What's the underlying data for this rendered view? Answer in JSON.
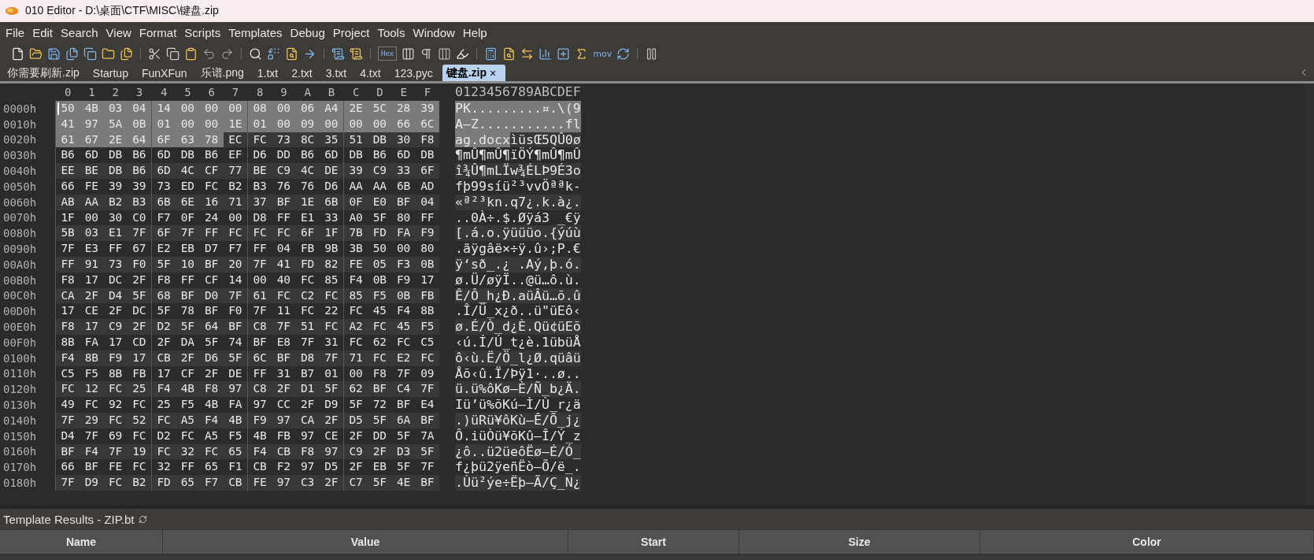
{
  "window": {
    "title": "010 Editor - D:\\桌面\\CTF\\MISC\\键盘.zip"
  },
  "menu": [
    "File",
    "Edit",
    "Search",
    "View",
    "Format",
    "Scripts",
    "Templates",
    "Debug",
    "Project",
    "Tools",
    "Window",
    "Help"
  ],
  "toolbar": {
    "hex_label": "Hex",
    "mov_label": "mov"
  },
  "tabs": [
    {
      "label": "你需要刷新.zip",
      "selected": false
    },
    {
      "label": "Startup",
      "selected": false
    },
    {
      "label": "FunXFun",
      "selected": false
    },
    {
      "label": "乐谱.png",
      "selected": false
    },
    {
      "label": "1.txt",
      "selected": false
    },
    {
      "label": "2.txt",
      "selected": false
    },
    {
      "label": "3.txt",
      "selected": false
    },
    {
      "label": "4.txt",
      "selected": false
    },
    {
      "label": "123.pyc",
      "selected": false
    },
    {
      "label": "键盘.zip",
      "selected": true,
      "close": "×"
    }
  ],
  "hex_view": {
    "columns": [
      "0",
      "1",
      "2",
      "3",
      "4",
      "5",
      "6",
      "7",
      "8",
      "9",
      "A",
      "B",
      "C",
      "D",
      "E",
      "F"
    ],
    "text_header": "0123456789ABCDEF",
    "rows": [
      {
        "offset": "0000h",
        "hex_selected": "50 4B 03 04 14 00 00 00 08 00 06 A4 2E 5C 28 39",
        "text_selected": "PK.........¤.\\(9"
      },
      {
        "offset": "0010h",
        "hex_selected": "41 97 5A 0B 01 00 00 1E 01 00 09 00 00 00 66 6C",
        "text_selected": "A—Z...........fl"
      },
      {
        "offset": "0020h",
        "hex_selected": "61 67 2E 64 6F 63 78",
        "hex": "EC FC 73 8C 35 51 DB 30 F8",
        "text_selected": "ag.docx",
        "text": "ìüsŒ5QÛ0ø"
      },
      {
        "offset": "0030h",
        "hex": "B6 6D DB B6 6D DB B6 EF D6 DD B6 6D DB B6 6D DB",
        "text": "¶mÛ¶mÛ¶ïÖÝ¶mÛ¶mÛ"
      },
      {
        "offset": "0040h",
        "hex": "EE BE DB B6 6D 4C CF 77 BE C9 4C DE 39 C9 33 6F",
        "text": "î¾Û¶mLÏw¾ÉLÞ9É3o"
      },
      {
        "offset": "0050h",
        "hex": "66 FE 39 39 73 ED FC B2 B3 76 76 D6 AA AA 6B AD",
        "text": "fþ99síü²³vvÖªªk-"
      },
      {
        "offset": "0060h",
        "hex": "AB AA B2 B3 6B 6E 16 71 37 BF 1E 6B 0F E0 BF 04",
        "text": "«ª²³kn.q7¿.k.à¿."
      },
      {
        "offset": "0070h",
        "hex": "1F 00 30 C0 F7 0F 24 00 D8 FF E1 33 A0 5F 80 FF",
        "text": "..0À÷.$.Øÿá3 _€ÿ"
      },
      {
        "offset": "0080h",
        "hex": "5B 03 E1 7F 6F 7F FF FC FC FC 6F 1F 7B FD FA F9",
        "text": "[.á.o.ÿüüüo.{ýúù"
      },
      {
        "offset": "0090h",
        "hex": "7F E3 FF 67 E2 EB D7 F7 FF 04 FB 9B 3B 50 00 80",
        "text": ".ãÿgâë×÷ÿ.û›;P.€"
      },
      {
        "offset": "00A0h",
        "hex": "FF 91 73 F0 5F 10 BF 20 7F 41 FD 82 FE 05 F3 0B",
        "text": "ÿ‘sð_.¿ .Aý‚þ.ó."
      },
      {
        "offset": "00B0h",
        "hex": "F8 17 DC 2F F8 FF CF 14 00 40 FC 85 F4 0B F9 17",
        "text": "ø.Ü/øÿÏ..@ü…ô.ù."
      },
      {
        "offset": "00C0h",
        "hex": "CA 2F D4 5F 68 BF D0 7F 61 FC C2 FC 85 F5 0B FB",
        "text": "Ê/Ô_h¿Ð.aüÂü…õ.û"
      },
      {
        "offset": "00D0h",
        "hex": "17 CE 2F DC 5F 78 BF F0 7F 11 FC 22 FC 45 F4 8B",
        "text": ".Î/Ü_x¿ð..ü\"üEô‹"
      },
      {
        "offset": "00E0h",
        "hex": "F8 17 C9 2F D2 5F 64 BF C8 7F 51 FC A2 FC 45 F5",
        "text": "ø.É/Ò_d¿È.Qü¢üEõ"
      },
      {
        "offset": "00F0h",
        "hex": "8B FA 17 CD 2F DA 5F 74 BF E8 7F 31 FC 62 FC C5",
        "text": "‹ú.Í/Ú_t¿è.1übüÅ"
      },
      {
        "offset": "0100h",
        "hex": "F4 8B F9 17 CB 2F D6 5F 6C BF D8 7F 71 FC E2 FC",
        "text": "ô‹ù.Ë/Ö_l¿Ø.qüâü"
      },
      {
        "offset": "0110h",
        "hex": "C5 F5 8B FB 17 CF 2F DE FF 31 B7 01 00 F8 7F 09",
        "text": "Åõ‹û.Ï/Þÿ1·..ø.."
      },
      {
        "offset": "0120h",
        "hex": "FC 12 FC 25 F4 4B F8 97 C8 2F D1 5F 62 BF C4 7F",
        "text": "ü.ü%ôKø—È/Ñ_b¿Ä."
      },
      {
        "offset": "0130h",
        "hex": "49 FC 92 FC 25 F5 4B FA 97 CC 2F D9 5F 72 BF E4",
        "text": "Iü’ü%õKú—Ì/Ù_r¿ä"
      },
      {
        "offset": "0140h",
        "hex": "7F 29 FC 52 FC A5 F4 4B F9 97 CA 2F D5 5F 6A BF",
        "text": ".)üRü¥ôKù—Ê/Õ_j¿"
      },
      {
        "offset": "0150h",
        "hex": "D4 7F 69 FC D2 FC A5 F5 4B FB 97 CE 2F DD 5F 7A",
        "text": "Ô.iüÒü¥õKû—Î/Ý_z"
      },
      {
        "offset": "0160h",
        "hex": "BF F4 7F 19 FC 32 FC 65 F4 CB F8 97 C9 2F D3 5F",
        "text": "¿ô..ü2üeôËø—É/Ó_"
      },
      {
        "offset": "0170h",
        "hex": "66 BF FE FC 32 FF 65 F1 CB F2 97 D5 2F EB 5F 7F",
        "text": "f¿þü2ÿeñËò—Õ/ë_."
      },
      {
        "offset": "0180h",
        "hex": "7F D9 FC B2 FD 65 F7 CB FE 97 C3 2F C7 5F 4E BF",
        "text": ".Ùü²ýe÷Ëþ—Ã/Ç_N¿"
      }
    ]
  },
  "template_results": {
    "title": "Template Results - ZIP.bt",
    "columns": [
      "Name",
      "Value",
      "Start",
      "Size",
      "Color"
    ]
  }
}
